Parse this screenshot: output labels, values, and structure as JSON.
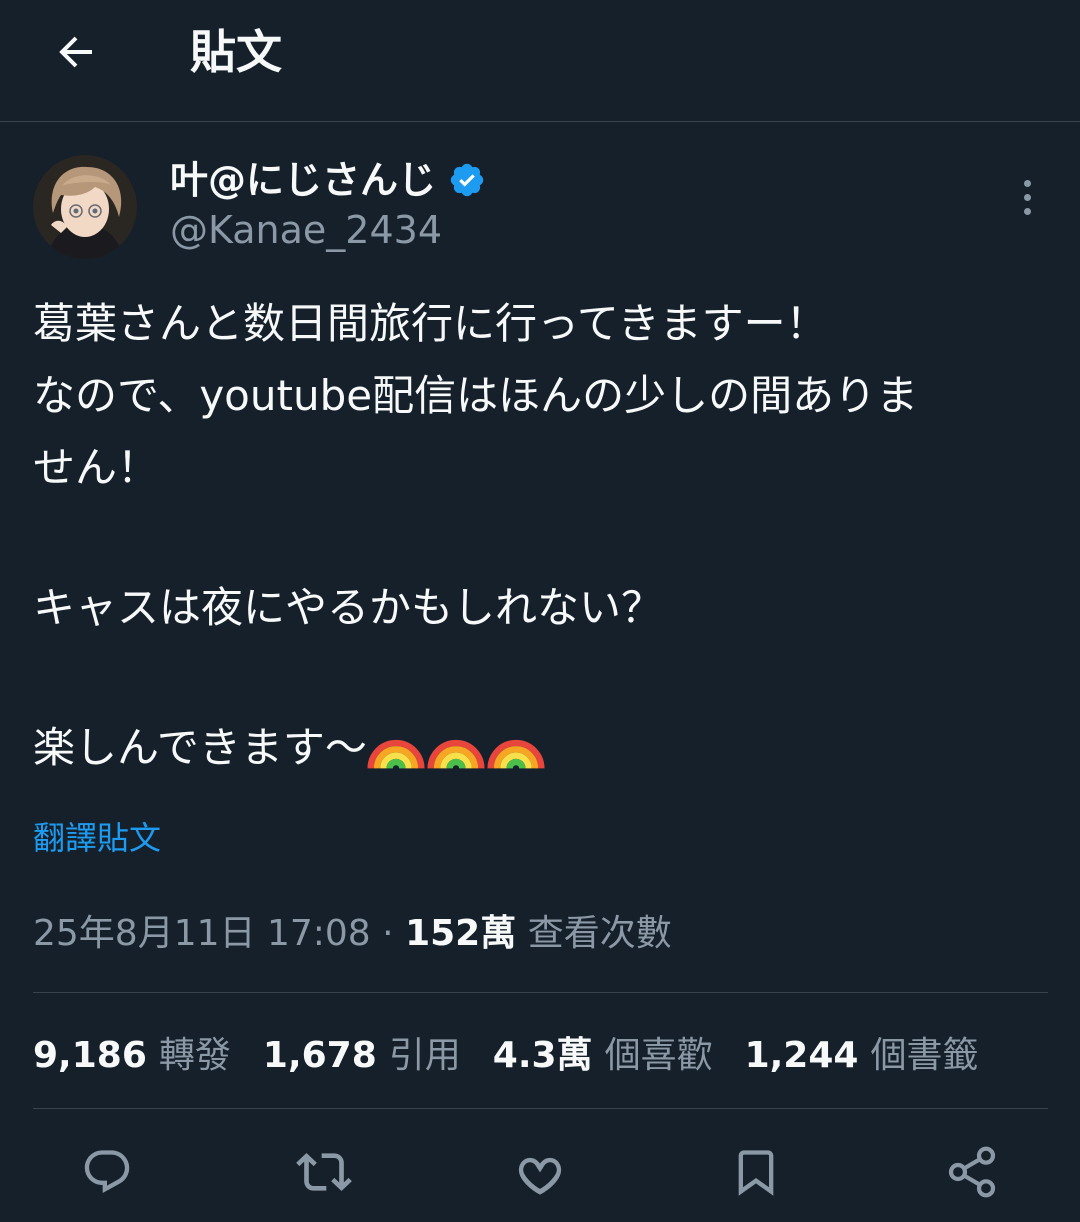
{
  "header": {
    "title": "貼文",
    "back_icon": "arrow-left-icon"
  },
  "author": {
    "display_name": "叶@にじさんじ",
    "handle": "@Kanae_2434",
    "verified": true
  },
  "tweet": {
    "lines": [
      "葛葉さんと数日間旅行に行ってきますー！",
      "なので、youtube配信はほんの少しの間ありま",
      "せん！",
      "",
      "キャスは夜にやるかもしれない？",
      "",
      "楽しんできます〜"
    ],
    "emoji": [
      "rainbow",
      "rainbow",
      "rainbow"
    ]
  },
  "translate_label": "翻譯貼文",
  "meta": {
    "timestamp": "25年8月11日 17:08",
    "separator": "·",
    "views": "152萬",
    "views_label": "查看次數"
  },
  "stats": [
    {
      "value": "9,186",
      "label": "轉發"
    },
    {
      "value": "1,678",
      "label": "引用"
    },
    {
      "value": "4.3萬",
      "label": "個喜歡"
    },
    {
      "value": "1,244",
      "label": "個書籤"
    }
  ],
  "actions": [
    "reply-icon",
    "retweet-icon",
    "like-icon",
    "bookmark-icon",
    "share-icon"
  ],
  "colors": {
    "background": "#15202b",
    "text": "#f7f9f9",
    "muted": "#8b98a5",
    "accent": "#1d9bf0",
    "divider": "#38444d"
  }
}
